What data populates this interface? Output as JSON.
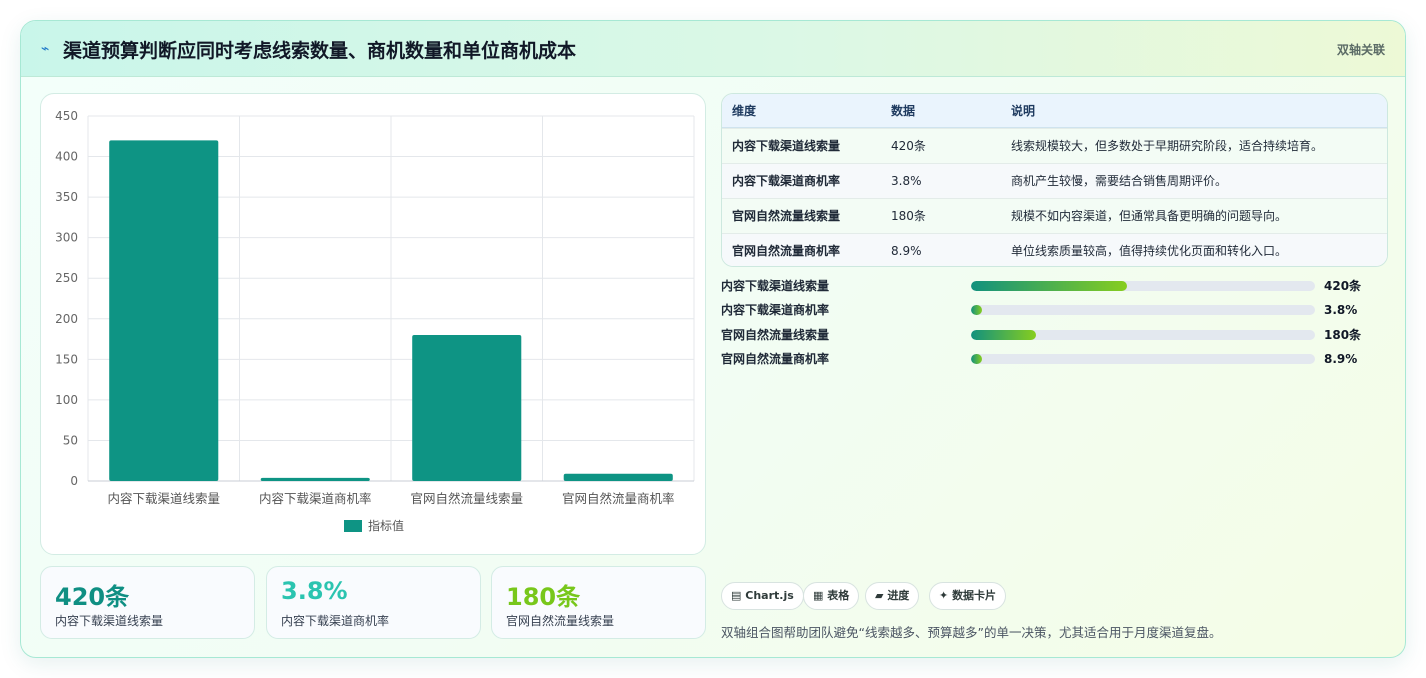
{
  "header": {
    "icon": "sparkline-icon",
    "title": "渠道预算判断应同时考虑线索数量、商机数量和单位商机成本",
    "tag": "双轴关联"
  },
  "chart_data": {
    "type": "bar",
    "categories": [
      "内容下载渠道线索量",
      "内容下载渠道商机率",
      "官网自然流量线索量",
      "官网自然流量商机率"
    ],
    "series": [
      {
        "name": "指标值",
        "values": [
          420,
          3.8,
          180,
          8.9
        ],
        "color": "#0e9484"
      }
    ],
    "ylim": [
      0,
      450
    ],
    "yticks": [
      0,
      50,
      100,
      150,
      200,
      250,
      300,
      350,
      400,
      450
    ],
    "grid": true,
    "legend": "bottom"
  },
  "stats": [
    {
      "value": "420条",
      "label": "内容下载渠道线索量",
      "color": "#0f8f83"
    },
    {
      "value": "3.8%",
      "label": "内容下载渠道商机率",
      "color": "#2bc4b0"
    },
    {
      "value": "180条",
      "label": "官网自然流量线索量",
      "color": "#78c71b"
    }
  ],
  "table": {
    "headers": [
      "维度",
      "数据",
      "说明"
    ],
    "rows": [
      {
        "dim": "内容下载渠道线索量",
        "data": "420条",
        "note": "线索规模较大，但多数处于早期研究阶段，适合持续培育。"
      },
      {
        "dim": "内容下载渠道商机率",
        "data": "3.8%",
        "note": "商机产生较慢，需要结合销售周期评价。"
      },
      {
        "dim": "官网自然流量线索量",
        "data": "180条",
        "note": "规模不如内容渠道，但通常具备更明确的问题导向。"
      },
      {
        "dim": "官网自然流量商机率",
        "data": "8.9%",
        "note": "单位线索质量较高，值得持续优化页面和转化入口。"
      }
    ]
  },
  "progress": [
    {
      "label": "内容下载渠道线索量",
      "value": "420条",
      "fraction": 0.453
    },
    {
      "label": "内容下载渠道商机率",
      "value": "3.8%",
      "fraction": 0.033
    },
    {
      "label": "官网自然流量线索量",
      "value": "180条",
      "fraction": 0.188
    },
    {
      "label": "官网自然流量商机率",
      "value": "8.9%",
      "fraction": 0.033
    }
  ],
  "chips": [
    {
      "icon": "chart-icon",
      "glyph": "▤",
      "label": "Chart.js"
    },
    {
      "icon": "table-icon",
      "glyph": "▦",
      "label": "表格"
    },
    {
      "icon": "progress-icon",
      "glyph": "▰",
      "label": "进度"
    },
    {
      "icon": "sparkle-icon",
      "glyph": "✦",
      "label": "数据卡片"
    }
  ],
  "footer": "双轴组合图帮助团队避免“线索越多、预算越多”的单一决策，尤其适合用于月度渠道复盘。"
}
